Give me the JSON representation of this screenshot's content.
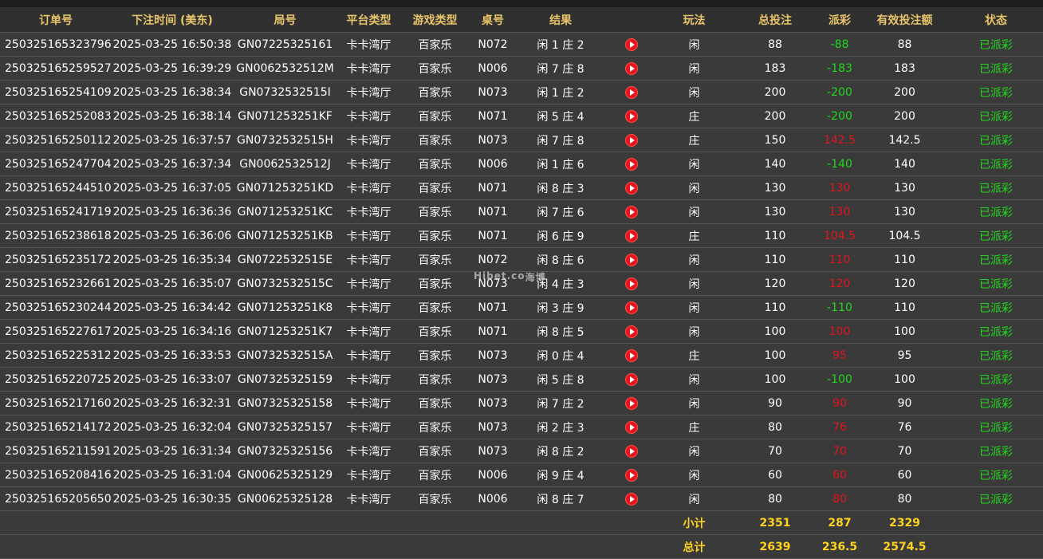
{
  "headers": [
    "订单号",
    "下注时间 (美东)",
    "局号",
    "平台类型",
    "游戏类型",
    "桌号",
    "结果",
    "",
    "玩法",
    "总投注",
    "派彩",
    "有效投注额",
    "状态"
  ],
  "rows": [
    {
      "order": "250325165323796",
      "time": "2025-03-25 16:50:38",
      "round": "GN07225325161",
      "platform": "卡卡湾厅",
      "game": "百家乐",
      "table": "N072",
      "result": "闲 1 庄 2",
      "play": "闲",
      "bet": "88",
      "payout": "-88",
      "payout_type": "win",
      "valid": "88",
      "status": "已派彩"
    },
    {
      "order": "250325165259527",
      "time": "2025-03-25 16:39:29",
      "round": "GN0062532512M",
      "platform": "卡卡湾厅",
      "game": "百家乐",
      "table": "N006",
      "result": "闲 7 庄 8",
      "play": "闲",
      "bet": "183",
      "payout": "-183",
      "payout_type": "win",
      "valid": "183",
      "status": "已派彩"
    },
    {
      "order": "250325165254109",
      "time": "2025-03-25 16:38:34",
      "round": "GN0732532515I",
      "platform": "卡卡湾厅",
      "game": "百家乐",
      "table": "N073",
      "result": "闲 1 庄 2",
      "play": "闲",
      "bet": "200",
      "payout": "-200",
      "payout_type": "win",
      "valid": "200",
      "status": "已派彩"
    },
    {
      "order": "250325165252083",
      "time": "2025-03-25 16:38:14",
      "round": "GN071253251KF",
      "platform": "卡卡湾厅",
      "game": "百家乐",
      "table": "N071",
      "result": "闲 5 庄 4",
      "play": "庄",
      "bet": "200",
      "payout": "-200",
      "payout_type": "win",
      "valid": "200",
      "status": "已派彩"
    },
    {
      "order": "250325165250112",
      "time": "2025-03-25 16:37:57",
      "round": "GN0732532515H",
      "platform": "卡卡湾厅",
      "game": "百家乐",
      "table": "N073",
      "result": "闲 7 庄 8",
      "play": "庄",
      "bet": "150",
      "payout": "142.5",
      "payout_type": "lose",
      "valid": "142.5",
      "status": "已派彩"
    },
    {
      "order": "250325165247704",
      "time": "2025-03-25 16:37:34",
      "round": "GN0062532512J",
      "platform": "卡卡湾厅",
      "game": "百家乐",
      "table": "N006",
      "result": "闲 1 庄 6",
      "play": "闲",
      "bet": "140",
      "payout": "-140",
      "payout_type": "win",
      "valid": "140",
      "status": "已派彩"
    },
    {
      "order": "250325165244510",
      "time": "2025-03-25 16:37:05",
      "round": "GN071253251KD",
      "platform": "卡卡湾厅",
      "game": "百家乐",
      "table": "N071",
      "result": "闲 8 庄 3",
      "play": "闲",
      "bet": "130",
      "payout": "130",
      "payout_type": "lose",
      "valid": "130",
      "status": "已派彩"
    },
    {
      "order": "250325165241719",
      "time": "2025-03-25 16:36:36",
      "round": "GN071253251KC",
      "platform": "卡卡湾厅",
      "game": "百家乐",
      "table": "N071",
      "result": "闲 7 庄 6",
      "play": "闲",
      "bet": "130",
      "payout": "130",
      "payout_type": "lose",
      "valid": "130",
      "status": "已派彩"
    },
    {
      "order": "250325165238618",
      "time": "2025-03-25 16:36:06",
      "round": "GN071253251KB",
      "platform": "卡卡湾厅",
      "game": "百家乐",
      "table": "N071",
      "result": "闲 6 庄 9",
      "play": "庄",
      "bet": "110",
      "payout": "104.5",
      "payout_type": "lose",
      "valid": "104.5",
      "status": "已派彩"
    },
    {
      "order": "250325165235172",
      "time": "2025-03-25 16:35:34",
      "round": "GN0722532515E",
      "platform": "卡卡湾厅",
      "game": "百家乐",
      "table": "N072",
      "result": "闲 8 庄 6",
      "play": "闲",
      "bet": "110",
      "payout": "110",
      "payout_type": "lose",
      "valid": "110",
      "status": "已派彩"
    },
    {
      "order": "250325165232661",
      "time": "2025-03-25 16:35:07",
      "round": "GN0732532515C",
      "platform": "卡卡湾厅",
      "game": "百家乐",
      "table": "N073",
      "result": "闲 4 庄 3",
      "play": "闲",
      "bet": "120",
      "payout": "120",
      "payout_type": "lose",
      "valid": "120",
      "status": "已派彩"
    },
    {
      "order": "250325165230244",
      "time": "2025-03-25 16:34:42",
      "round": "GN071253251K8",
      "platform": "卡卡湾厅",
      "game": "百家乐",
      "table": "N071",
      "result": "闲 3 庄 9",
      "play": "闲",
      "bet": "110",
      "payout": "-110",
      "payout_type": "win",
      "valid": "110",
      "status": "已派彩"
    },
    {
      "order": "250325165227617",
      "time": "2025-03-25 16:34:16",
      "round": "GN071253251K7",
      "platform": "卡卡湾厅",
      "game": "百家乐",
      "table": "N071",
      "result": "闲 8 庄 5",
      "play": "闲",
      "bet": "100",
      "payout": "100",
      "payout_type": "lose",
      "valid": "100",
      "status": "已派彩"
    },
    {
      "order": "250325165225312",
      "time": "2025-03-25 16:33:53",
      "round": "GN0732532515A",
      "platform": "卡卡湾厅",
      "game": "百家乐",
      "table": "N073",
      "result": "闲 0 庄 4",
      "play": "庄",
      "bet": "100",
      "payout": "95",
      "payout_type": "lose",
      "valid": "95",
      "status": "已派彩"
    },
    {
      "order": "250325165220725",
      "time": "2025-03-25 16:33:07",
      "round": "GN07325325159",
      "platform": "卡卡湾厅",
      "game": "百家乐",
      "table": "N073",
      "result": "闲 5 庄 8",
      "play": "闲",
      "bet": "100",
      "payout": "-100",
      "payout_type": "win",
      "valid": "100",
      "status": "已派彩"
    },
    {
      "order": "250325165217160",
      "time": "2025-03-25 16:32:31",
      "round": "GN07325325158",
      "platform": "卡卡湾厅",
      "game": "百家乐",
      "table": "N073",
      "result": "闲 7 庄 2",
      "play": "闲",
      "bet": "90",
      "payout": "90",
      "payout_type": "lose",
      "valid": "90",
      "status": "已派彩"
    },
    {
      "order": "250325165214172",
      "time": "2025-03-25 16:32:04",
      "round": "GN07325325157",
      "platform": "卡卡湾厅",
      "game": "百家乐",
      "table": "N073",
      "result": "闲 2 庄 3",
      "play": "庄",
      "bet": "80",
      "payout": "76",
      "payout_type": "lose",
      "valid": "76",
      "status": "已派彩"
    },
    {
      "order": "250325165211591",
      "time": "2025-03-25 16:31:34",
      "round": "GN07325325156",
      "platform": "卡卡湾厅",
      "game": "百家乐",
      "table": "N073",
      "result": "闲 8 庄 2",
      "play": "闲",
      "bet": "70",
      "payout": "70",
      "payout_type": "lose",
      "valid": "70",
      "status": "已派彩"
    },
    {
      "order": "250325165208416",
      "time": "2025-03-25 16:31:04",
      "round": "GN00625325129",
      "platform": "卡卡湾厅",
      "game": "百家乐",
      "table": "N006",
      "result": "闲 9 庄 4",
      "play": "闲",
      "bet": "60",
      "payout": "60",
      "payout_type": "lose",
      "valid": "60",
      "status": "已派彩"
    },
    {
      "order": "250325165205650",
      "time": "2025-03-25 16:30:35",
      "round": "GN00625325128",
      "platform": "卡卡湾厅",
      "game": "百家乐",
      "table": "N006",
      "result": "闲 8 庄 7",
      "play": "闲",
      "bet": "80",
      "payout": "80",
      "payout_type": "lose",
      "valid": "80",
      "status": "已派彩"
    }
  ],
  "subtotal": {
    "label": "小计",
    "bet": "2351",
    "payout": "287",
    "valid": "2329"
  },
  "total": {
    "label": "总计",
    "bet": "2639",
    "payout": "236.5",
    "valid": "2574.5"
  },
  "watermark": {
    "main": "Hibet.co",
    "small": "海博"
  },
  "icons": {
    "result_video": "play-icon"
  },
  "colors": {
    "header_text": "#e8c46a",
    "win": "#22d81c",
    "lose": "#e1141e",
    "total_text": "#ffd21e",
    "row_bg": "#3a3a3a"
  }
}
